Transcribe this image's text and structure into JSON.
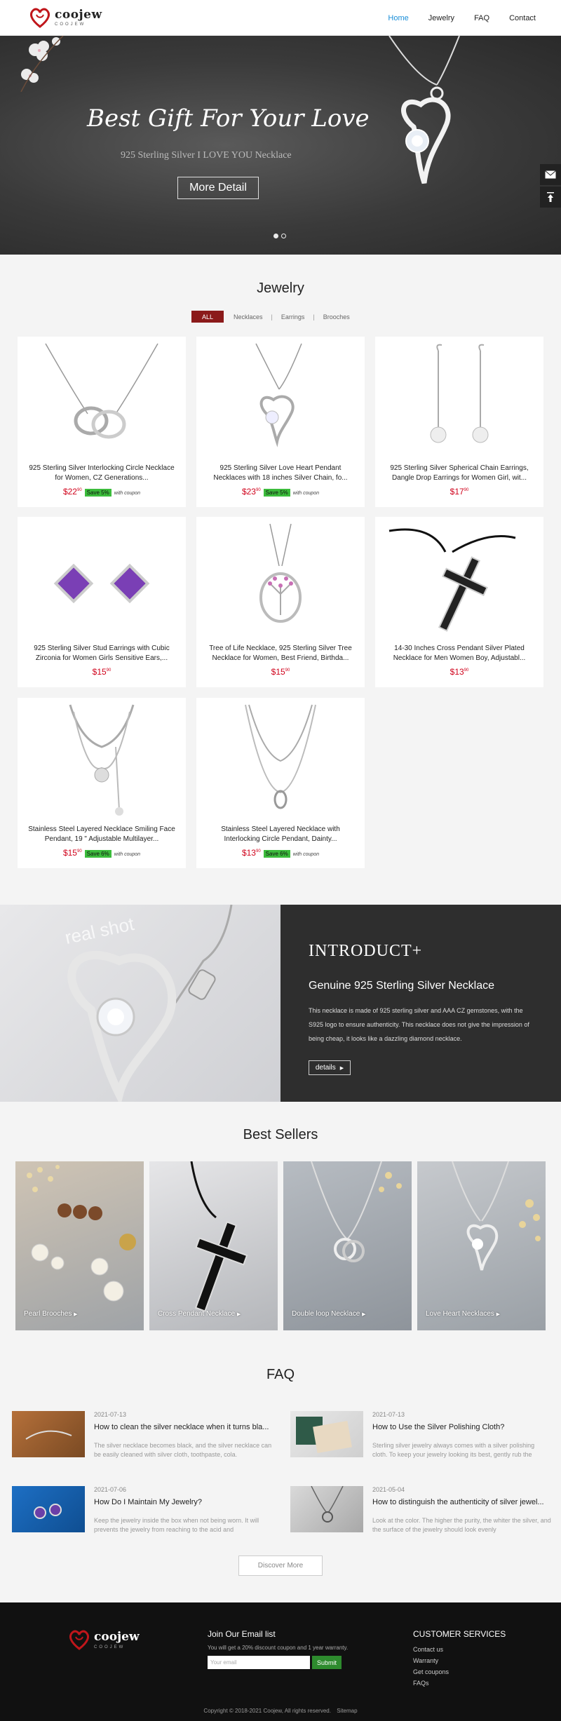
{
  "header": {
    "logo_word": "coojew",
    "logo_sub": "COOJEW",
    "nav": [
      {
        "label": "Home",
        "active": true
      },
      {
        "label": "Jewelry",
        "active": false
      },
      {
        "label": "FAQ",
        "active": false
      },
      {
        "label": "Contact",
        "active": false
      }
    ]
  },
  "hero": {
    "title": "Best Gift For Your Love",
    "subtitle": "925 Sterling Silver I LOVE YOU Necklace",
    "button": "More Detail",
    "slides": 2,
    "active_slide": 1
  },
  "side_tools": [
    "mail-icon",
    "back-to-top-icon"
  ],
  "jewelry": {
    "title": "Jewelry",
    "filters": [
      "ALL",
      "Necklaces",
      "Earrings",
      "Brooches"
    ],
    "products": [
      {
        "name": "925 Sterling Silver Interlocking Circle Necklace for Women, CZ Generations...",
        "price_main": "22",
        "price_cents": "90",
        "save": "Save 5%",
        "coupon": "with coupon"
      },
      {
        "name": "925 Sterling Silver Love Heart Pendant Necklaces with 18 inches Silver Chain, fo...",
        "price_main": "23",
        "price_cents": "90",
        "save": "Save 5%",
        "coupon": "with coupon"
      },
      {
        "name": "925 Sterling Silver Spherical Chain Earrings, Dangle Drop Earrings for Women Girl, wit...",
        "price_main": "17",
        "price_cents": "90",
        "save": "",
        "coupon": ""
      },
      {
        "name": "925 Sterling Silver Stud Earrings with Cubic Zirconia for Women Girls Sensitive Ears,...",
        "price_main": "15",
        "price_cents": "90",
        "save": "",
        "coupon": ""
      },
      {
        "name": "Tree of Life Necklace, 925 Sterling Silver Tree Necklace for Women, Best Friend, Birthda...",
        "price_main": "15",
        "price_cents": "90",
        "save": "",
        "coupon": ""
      },
      {
        "name": "14-30 Inches Cross Pendant Silver Plated Necklace for Men Women Boy, Adjustabl...",
        "price_main": "13",
        "price_cents": "90",
        "save": "",
        "coupon": ""
      },
      {
        "name": "Stainless Steel Layered Necklace Smiling Face Pendant, 19 \" Adjustable Multilayer...",
        "price_main": "15",
        "price_cents": "90",
        "save": "Save 6%",
        "coupon": "with coupon"
      },
      {
        "name": "Stainless Steel Layered Necklace with Interlocking Circle Pendant, Dainty...",
        "price_main": "13",
        "price_cents": "90",
        "save": "Save 6%",
        "coupon": "with coupon"
      }
    ]
  },
  "intro": {
    "watermark": "real shot",
    "heading": "INTRODUCT+",
    "subheading": "Genuine 925 Sterling Silver Necklace",
    "text": "This necklace is made of 925 sterling silver and AAA CZ gemstones, with the S925 logo to ensure authenticity. This necklace does not give the impression of being cheap, it looks like a dazzling diamond necklace.",
    "button": "details"
  },
  "best_sellers": {
    "title": "Best Sellers",
    "items": [
      "Pearl Brooches",
      "Cross Pendant Necklace",
      "Double loop Necklace",
      "Love Heart Necklaces"
    ]
  },
  "faq": {
    "title": "FAQ",
    "items": [
      {
        "date": "2021-07-13",
        "question": "How to clean the silver necklace when it turns bla...",
        "answer": "The silver necklace becomes black, and the silver necklace can be easily cleaned with silver cloth, toothpaste, cola."
      },
      {
        "date": "2021-07-13",
        "question": "How to Use the Silver Polishing Cloth?",
        "answer": "Sterling silver jewelry always comes with a silver polishing cloth. To keep your jewelry looking its best, gently rub the"
      },
      {
        "date": "2021-07-06",
        "question": "How Do I Maintain My Jewelry?",
        "answer": "Keep the jewelry inside the box when not being worn. It will prevents the jewelry from reaching to the acid and"
      },
      {
        "date": "2021-05-04",
        "question": "How to distinguish the authenticity of silver jewel...",
        "answer": "Look at the color. The higher the purity, the whiter the silver, and the surface of the jewelry should look evenly"
      }
    ],
    "discover": "Discover More"
  },
  "footer": {
    "email_title": "Join Our Email list",
    "email_desc": "You will get a 20% discount coupon and 1 year warranty.",
    "email_placeholder": "Your email",
    "submit": "Submit",
    "cs_title": "CUSTOMER SERVICES",
    "cs_links": [
      "Contact us",
      "Warranty",
      "Get coupons",
      "FAQs"
    ],
    "copyright": "Copyright © 2018-2021 Coojew, All rights reserved.",
    "sitemap": "Sitemap"
  },
  "colors": {
    "accent": "#1a8ed8",
    "filter_active": "#8b1a1a",
    "price": "#d0021b",
    "save_badge": "#3cbc3c",
    "submit": "#2e8b2e"
  }
}
